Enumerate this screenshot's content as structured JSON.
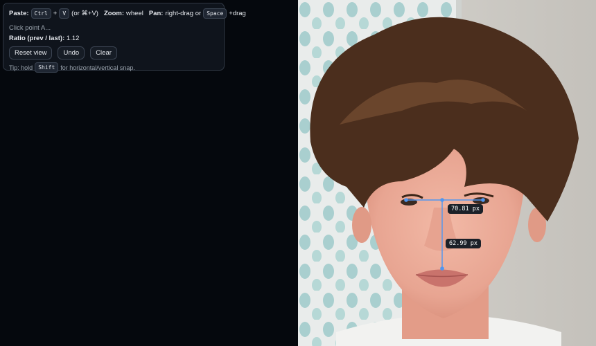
{
  "help": {
    "paste_label": "Paste:",
    "paste_key1": "Ctrl",
    "plus": "+",
    "paste_key2": "V",
    "paste_alt": "(or ⌘+V)",
    "zoom_label": "Zoom:",
    "zoom_value": "wheel",
    "pan_label": "Pan:",
    "pan_value": "right-drag or",
    "pan_key": "Space",
    "pan_suffix": "+drag"
  },
  "status_text": "Click point A...",
  "ratio": {
    "label": "Ratio (prev / last):",
    "value": "1.12"
  },
  "buttons": {
    "reset": "Reset view",
    "undo": "Undo",
    "clear": "Clear"
  },
  "tip": {
    "prefix": "Tip: hold",
    "key": "Shift",
    "suffix": "for horizontal/vertical snap."
  },
  "measurements": [
    {
      "label": "70.81 px",
      "orientation": "horizontal"
    },
    {
      "label": "62.99 px",
      "orientation": "vertical"
    }
  ],
  "colors": {
    "measure_line": "#4f96f0",
    "panel_bg": "#0f141c",
    "canvas_bg": "#05080d"
  }
}
